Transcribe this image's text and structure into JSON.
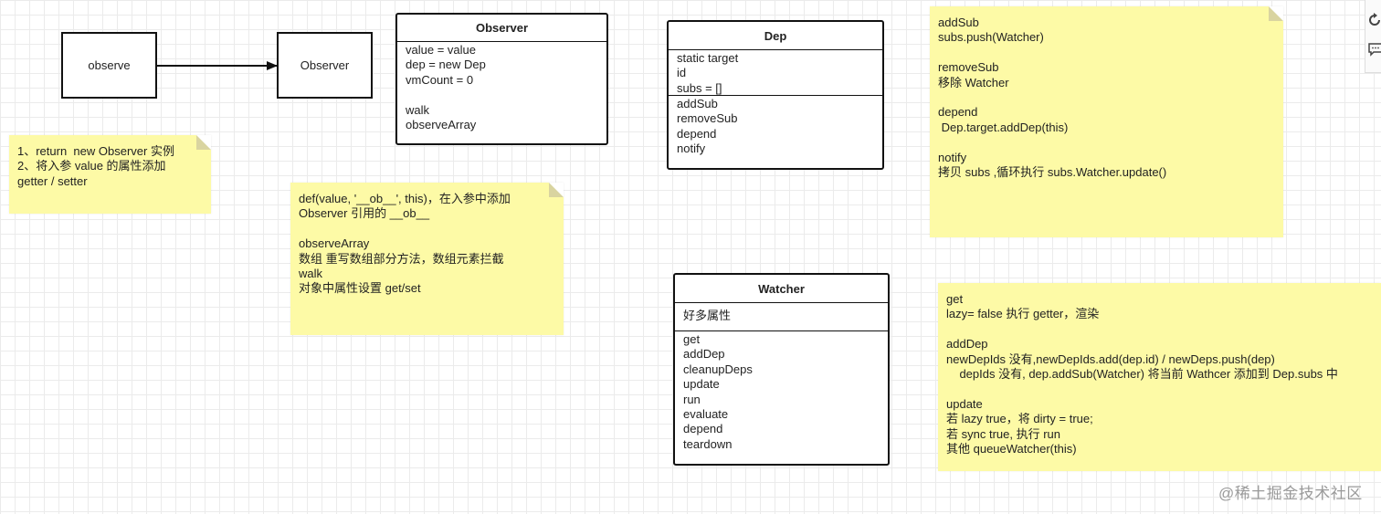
{
  "diagram": {
    "boxes": {
      "observe": "observe",
      "observer": "Observer"
    },
    "observer_class": {
      "title": "Observer",
      "fields": [
        "value = value",
        "dep = new Dep",
        "vmCount = 0",
        "",
        "walk",
        "observeArray"
      ]
    },
    "dep_class": {
      "title": "Dep",
      "fields": [
        "static target",
        "id",
        "subs = []"
      ],
      "methods": [
        "addSub",
        "removeSub",
        "depend",
        "notify"
      ]
    },
    "watcher_class": {
      "title": "Watcher",
      "fields": [
        "好多属性"
      ],
      "methods": [
        "get",
        "addDep",
        "cleanupDeps",
        "update",
        "run",
        "evaluate",
        "depend",
        "teardown"
      ]
    },
    "notes": {
      "observe_note": [
        "1、return  new Observer 实例",
        "2、将入参 value 的属性添加",
        "getter / setter"
      ],
      "observer_note": [
        "def(value, '__ob__', this)，在入参中添加",
        "Observer 引用的 __ob__",
        "",
        "observeArray",
        "数组 重写数组部分方法，数组元素拦截",
        "walk",
        "对象中属性设置 get/set"
      ],
      "dep_note": [
        "addSub",
        "subs.push(Watcher)",
        "",
        "removeSub",
        "移除 Watcher",
        "",
        "depend",
        " Dep.target.addDep(this)",
        "",
        "notify",
        "拷贝 subs ,循环执行 subs.Watcher.update()"
      ],
      "watcher_note": [
        "get",
        "lazy= false 执行 getter，渲染",
        "",
        "addDep",
        "newDepIds 没有,newDepIds.add(dep.id) / newDeps.push(dep)",
        "    depIds 没有, dep.addSub(Watcher) 将当前 Wathcer 添加到 Dep.subs 中",
        "",
        "update",
        "若 lazy true，将 dirty = true;",
        "若 sync true, 执行 run",
        "其他 queueWatcher(this)"
      ]
    }
  },
  "watermark": "@稀土掘金技术社区",
  "toolbar": {
    "icons": [
      "rotate-icon",
      "comment-icon"
    ]
  }
}
